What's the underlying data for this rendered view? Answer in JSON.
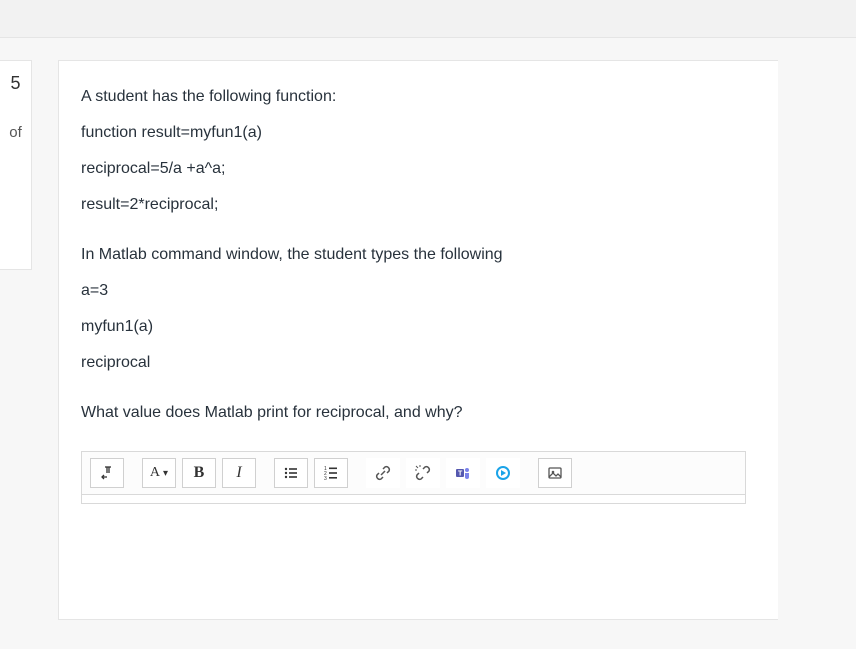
{
  "sidebar": {
    "question_number": "5",
    "of_label": "of"
  },
  "question": {
    "intro": "A student has the following function:",
    "code_line1": "function result=myfun1(a)",
    "code_line2": "reciprocal=5/a +a^a;",
    "code_line3": "result=2*reciprocal;",
    "cmd_intro": "In Matlab command window, the student types the following",
    "cmd_line1": "a=3",
    "cmd_line2": "myfun1(a)",
    "cmd_line3": "reciprocal",
    "prompt": "What value does Matlab print for reciprocal, and why?"
  },
  "toolbar": {
    "paragraph_label": "↳",
    "font_label": "A",
    "bold_label": "B",
    "italic_label": "I",
    "bullets_label": "≡",
    "numbered_label": "≡",
    "link_label": "link",
    "unlink_label": "unlink",
    "teams_label": "teams",
    "record_label": "record",
    "image_label": "image"
  }
}
